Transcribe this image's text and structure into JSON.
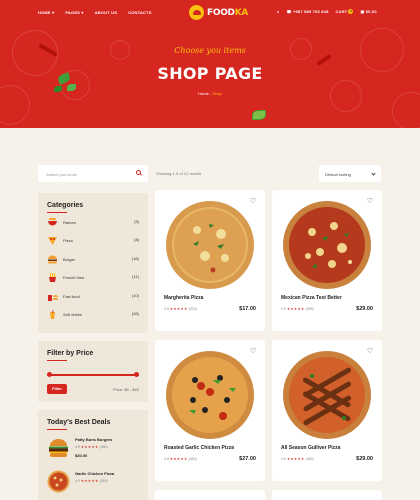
{
  "header": {
    "nav": [
      "HOME",
      "PAGES",
      "ABOUT US",
      "CONTACTS"
    ],
    "logo": {
      "prefix": "FOOD",
      "suffix": "KA"
    },
    "phone": "+987 589 763 848",
    "cart_label": "CART",
    "cart_count": "0",
    "cart_total": "$0,00"
  },
  "hero": {
    "subtitle": "Choose you items",
    "title": "SHOP PAGE",
    "breadcrumb_home": "Home",
    "breadcrumb_sep": " - ",
    "breadcrumb_current": "Shop"
  },
  "toolbar": {
    "search_placeholder": "Search you items",
    "results": "Showing 1-9 of 12 results",
    "sort": "Default sorting"
  },
  "categories": {
    "title": "Categories",
    "items": [
      {
        "name": "Ramen",
        "count": "(5)"
      },
      {
        "name": "Pizza",
        "count": "(8)"
      },
      {
        "name": "Burger",
        "count": "(18)"
      },
      {
        "name": "French fries",
        "count": "(11)"
      },
      {
        "name": "Fast food",
        "count": "(10)"
      },
      {
        "name": "Soft drinks",
        "count": "(28)"
      }
    ]
  },
  "filter": {
    "title": "Filter by Price",
    "button": "Filter",
    "label": "Price: $5 - $40"
  },
  "deals": {
    "title": "Today's Best Deals",
    "items": [
      {
        "name": "Patty Buns Burgers",
        "rating": "4.9",
        "reviews": "(480)",
        "price": "$30.00"
      },
      {
        "name": "Garlic Chicken Pizza",
        "rating": "4.9",
        "reviews": "(480)",
        "price": ""
      }
    ]
  },
  "products": [
    {
      "name": "Margherita Pizza",
      "rating": "4.9",
      "reviews": "(200)",
      "price": "$17.00"
    },
    {
      "name": "Mexican Pizza Test Better",
      "rating": "4.9",
      "reviews": "(928)",
      "price": "$29.00"
    },
    {
      "name": "Roasted Garlic Chicken Pizza",
      "rating": "4.9",
      "reviews": "(482)",
      "price": "$27.00"
    },
    {
      "name": "All Season Gulliver Pizza",
      "rating": "4.9",
      "reviews": "(482)",
      "price": "$29.00"
    }
  ],
  "stars": "★★★★★",
  "colors": {
    "brand_red": "#d62620",
    "accent_yellow": "#f9c00c",
    "panel": "#efe8da",
    "background": "#f6f2ea"
  }
}
